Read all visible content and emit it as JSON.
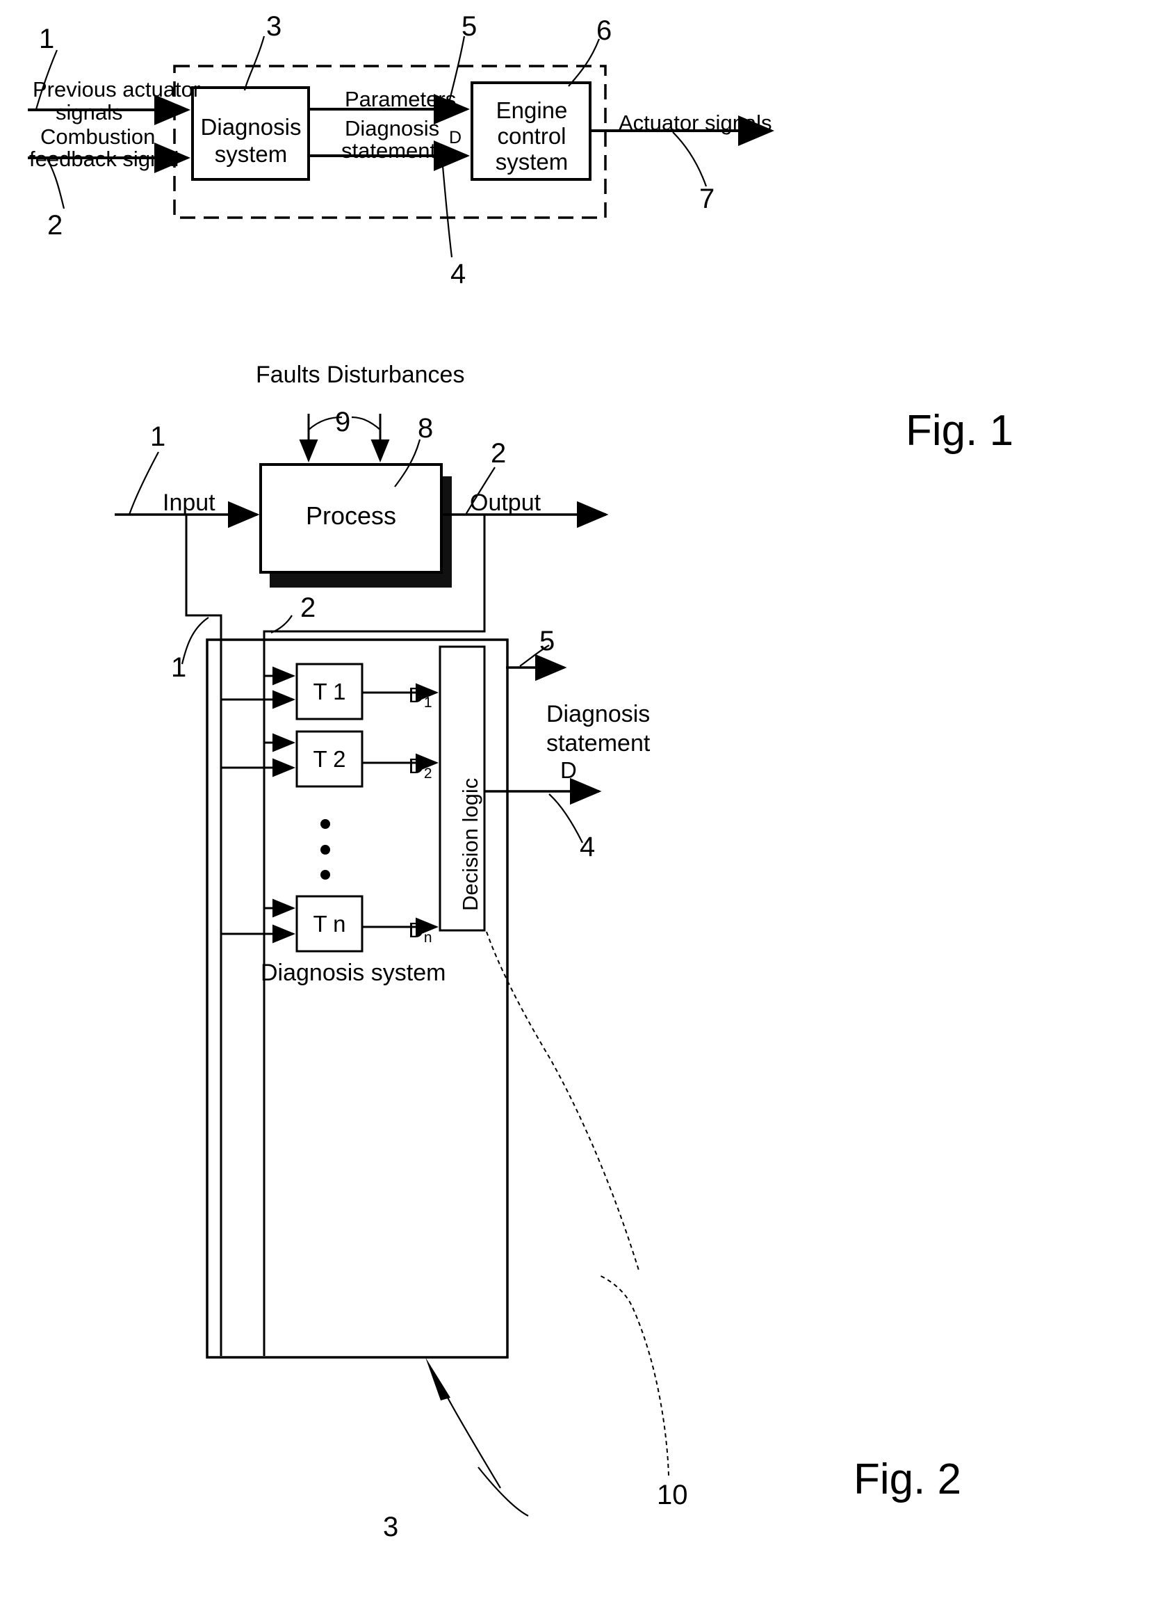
{
  "document": {
    "kind": "patent-drawing-sheet",
    "figures": [
      "Fig. 1",
      "Fig. 2"
    ]
  },
  "fig1": {
    "caption": "Fig. 1",
    "blocks": [
      {
        "id": "diagnosis-system",
        "line1": "Diagnosis",
        "line2": "system"
      },
      {
        "id": "engine-control-system",
        "line1": "Engine",
        "line2": "control",
        "line3": "system"
      }
    ],
    "signals": {
      "previous_actuator_signals_l1": "Previous actuator",
      "previous_actuator_signals_l2": "signals",
      "combustion_feedback_l1": "Combustion",
      "combustion_feedback_l2": "feedback signal",
      "parameters": "Parameters",
      "diagnosis_statement_l1": "Diagnosis",
      "diagnosis_statement_l2": "statement",
      "d_symbol": "D",
      "actuator_signals": "Actuator signals"
    },
    "refs": {
      "r1": "1",
      "r2": "2",
      "r3": "3",
      "r4": "4",
      "r5": "5",
      "r6": "6",
      "r7": "7"
    }
  },
  "fig2": {
    "caption": "Fig. 2",
    "title": "Faults Disturbances",
    "blocks": {
      "process": "Process",
      "decision_logic": "Decision logic",
      "diagnosis_system": "Diagnosis system",
      "tests": [
        {
          "label": "T 1",
          "out": "D",
          "out_sub": "1"
        },
        {
          "label": "T 2",
          "out": "D",
          "out_sub": "2"
        },
        {
          "label": "T n",
          "out": "D",
          "out_sub": "n"
        }
      ]
    },
    "signals": {
      "input": "Input",
      "output": "Output",
      "diagnosis_statement_l1": "Diagnosis",
      "diagnosis_statement_l2": "statement",
      "d_symbol": "D"
    },
    "refs": {
      "r1_top": "1",
      "r2_top": "2",
      "r9": "9",
      "r8": "8",
      "r1_mid": "1",
      "r2_mid": "2",
      "r5": "5",
      "r4": "4",
      "r3": "3",
      "r10": "10"
    }
  },
  "colors": {
    "ink": "#000000",
    "paper": "#ffffff"
  }
}
